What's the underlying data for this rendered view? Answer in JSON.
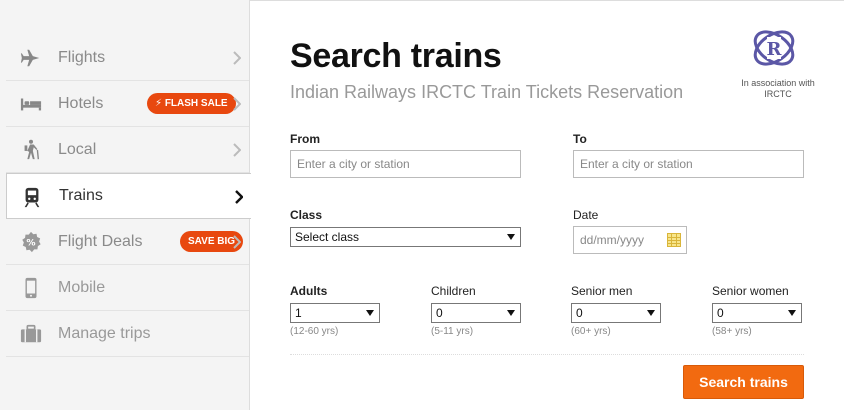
{
  "sidebar": {
    "items": [
      {
        "label": "Flights",
        "icon": "plane-icon"
      },
      {
        "label": "Hotels",
        "icon": "bed-icon",
        "badge": "FLASH SALE"
      },
      {
        "label": "Local",
        "icon": "hiker-icon"
      },
      {
        "label": "Trains",
        "icon": "train-icon",
        "active": true
      },
      {
        "label": "Flight Deals",
        "icon": "percent-icon",
        "badge": "SAVE BIG"
      },
      {
        "label": "Mobile",
        "icon": "mobile-icon"
      },
      {
        "label": "Manage trips",
        "icon": "briefcase-icon"
      }
    ]
  },
  "header": {
    "title": "Search trains",
    "subtitle": "Indian Railways IRCTC Train Tickets Reservation",
    "logo_text_line1": "In association with",
    "logo_text_line2": "IRCTC"
  },
  "form": {
    "from_label": "From",
    "from_placeholder": "Enter a city or station",
    "to_label": "To",
    "to_placeholder": "Enter a city or station",
    "class_label": "Class",
    "class_value": "Select class",
    "date_label": "Date",
    "date_placeholder": "dd/mm/yyyy",
    "passengers": [
      {
        "label": "Adults",
        "value": "1",
        "hint": "(12-60 yrs)"
      },
      {
        "label": "Children",
        "value": "0",
        "hint": "(5-11 yrs)"
      },
      {
        "label": "Senior men",
        "value": "0",
        "hint": "(60+ yrs)"
      },
      {
        "label": "Senior women",
        "value": "0",
        "hint": "(58+ yrs)"
      }
    ],
    "submit_label": "Search trains"
  },
  "colors": {
    "accent": "#f26a10",
    "badge": "#e8480f"
  }
}
